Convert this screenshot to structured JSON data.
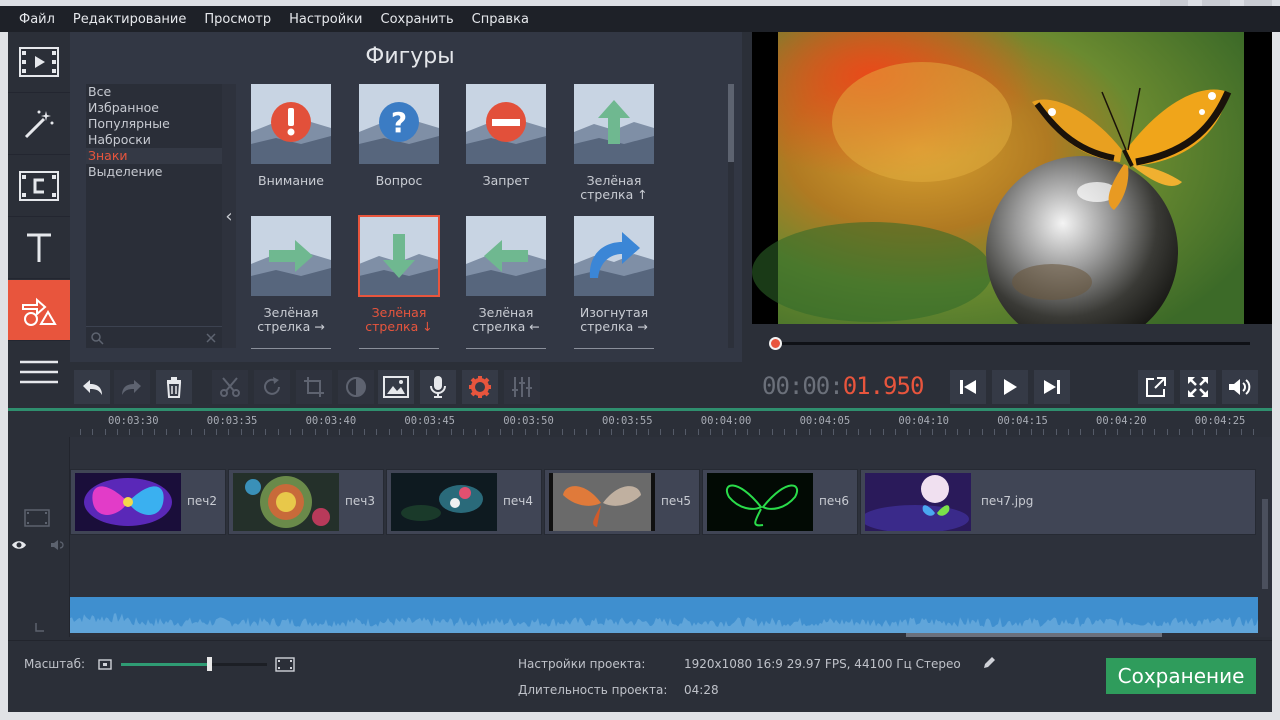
{
  "menu": [
    "Файл",
    "Редактирование",
    "Просмотр",
    "Настройки",
    "Сохранить",
    "Справка"
  ],
  "rail": [
    "film-icon",
    "magic-wand-icon",
    "titles-icon",
    "text-icon",
    "shapes-icon",
    "list-icon"
  ],
  "panel": {
    "title": "Фигуры",
    "categories": [
      "Все",
      "Избранное",
      "Популярные",
      "Наброски",
      "Знаки",
      "Выделение"
    ],
    "selected_category": "Знаки",
    "tiles": [
      {
        "label": "Внимание",
        "icon": "warning-icon"
      },
      {
        "label": "Вопрос",
        "icon": "question-icon"
      },
      {
        "label": "Запрет",
        "icon": "no-entry-icon"
      },
      {
        "label": "Зелёная стрелка ↑",
        "icon": "arrow-up-icon"
      },
      {
        "label": "Зелёная стрелка →",
        "icon": "arrow-right-icon"
      },
      {
        "label": "Зелёная стрелка ↓",
        "icon": "arrow-down-icon"
      },
      {
        "label": "Зелёная стрелка ←",
        "icon": "arrow-left-icon"
      },
      {
        "label": "Изогнутая стрелка →",
        "icon": "curved-arrow-icon"
      }
    ],
    "selected_tile": "Зелёная стрелка ↓"
  },
  "player": {
    "time_dim": "00:00:",
    "time_active": "01.950"
  },
  "ruler": [
    "00:03:30",
    "00:03:35",
    "00:03:40",
    "00:03:45",
    "00:03:50",
    "00:03:55",
    "00:04:00",
    "00:04:05",
    "00:04:10",
    "00:04:15",
    "00:04:20",
    "00:04:25"
  ],
  "clips": [
    "печ2",
    "печ3",
    "печ4",
    "печ5",
    "печ6",
    "печ7.jpg"
  ],
  "bottom": {
    "zoom_label": "Масштаб:",
    "zoom_level": 0.6,
    "settings_label": "Настройки проекта:",
    "settings_value": "1920x1080 16:9 29.97 FPS, 44100 Гц Стерео",
    "duration_label": "Длительность проекта:",
    "duration_value": "04:28",
    "save_button": "Сохранение"
  },
  "colors": {
    "accent": "#e8553d",
    "save_green": "#2f9c5c",
    "timeline_green": "#2f8f6e",
    "audio_blue": "#3f8fcf"
  }
}
